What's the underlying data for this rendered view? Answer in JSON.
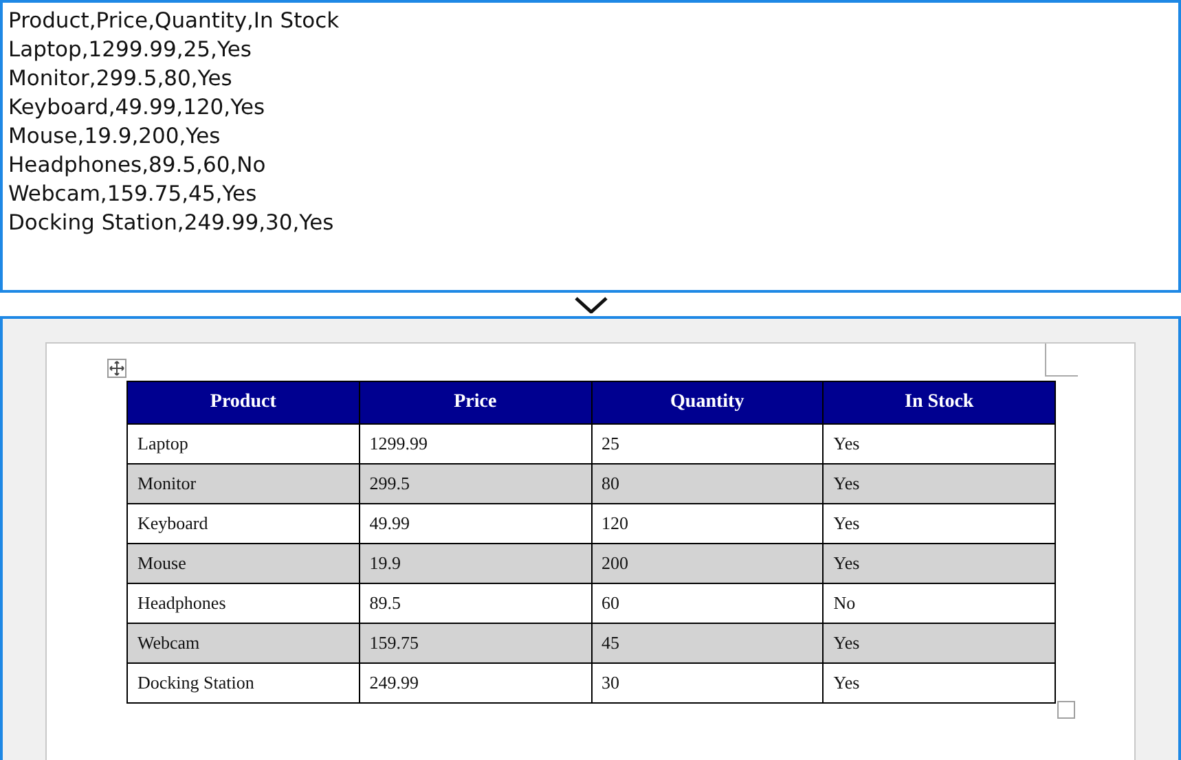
{
  "csv_editor": {
    "lines": [
      "Product,Price,Quantity,In Stock",
      "Laptop,1299.99,25,Yes",
      "Monitor,299.5,80,Yes",
      "Keyboard,49.99,120,Yes",
      "Mouse,19.9,200,Yes",
      "Headphones,89.5,60,No",
      "Webcam,159.75,45,Yes",
      "Docking Station,249.99,30,Yes"
    ]
  },
  "document": {
    "table": {
      "columns": [
        "Product",
        "Price",
        "Quantity",
        "In Stock"
      ],
      "rows": [
        {
          "cells": [
            "Laptop",
            "1299.99",
            "25",
            "Yes"
          ],
          "shaded": false
        },
        {
          "cells": [
            "Monitor",
            "299.5",
            "80",
            "Yes"
          ],
          "shaded": true
        },
        {
          "cells": [
            "Keyboard",
            "49.99",
            "120",
            "Yes"
          ],
          "shaded": false
        },
        {
          "cells": [
            "Mouse",
            "19.9",
            "200",
            "Yes"
          ],
          "shaded": true
        },
        {
          "cells": [
            "Headphones",
            "89.5",
            "60",
            "No"
          ],
          "shaded": false
        },
        {
          "cells": [
            "Webcam",
            "159.75",
            "45",
            "Yes"
          ],
          "shaded": true
        },
        {
          "cells": [
            "Docking Station",
            "249.99",
            "30",
            "Yes"
          ],
          "shaded": false
        }
      ]
    }
  }
}
